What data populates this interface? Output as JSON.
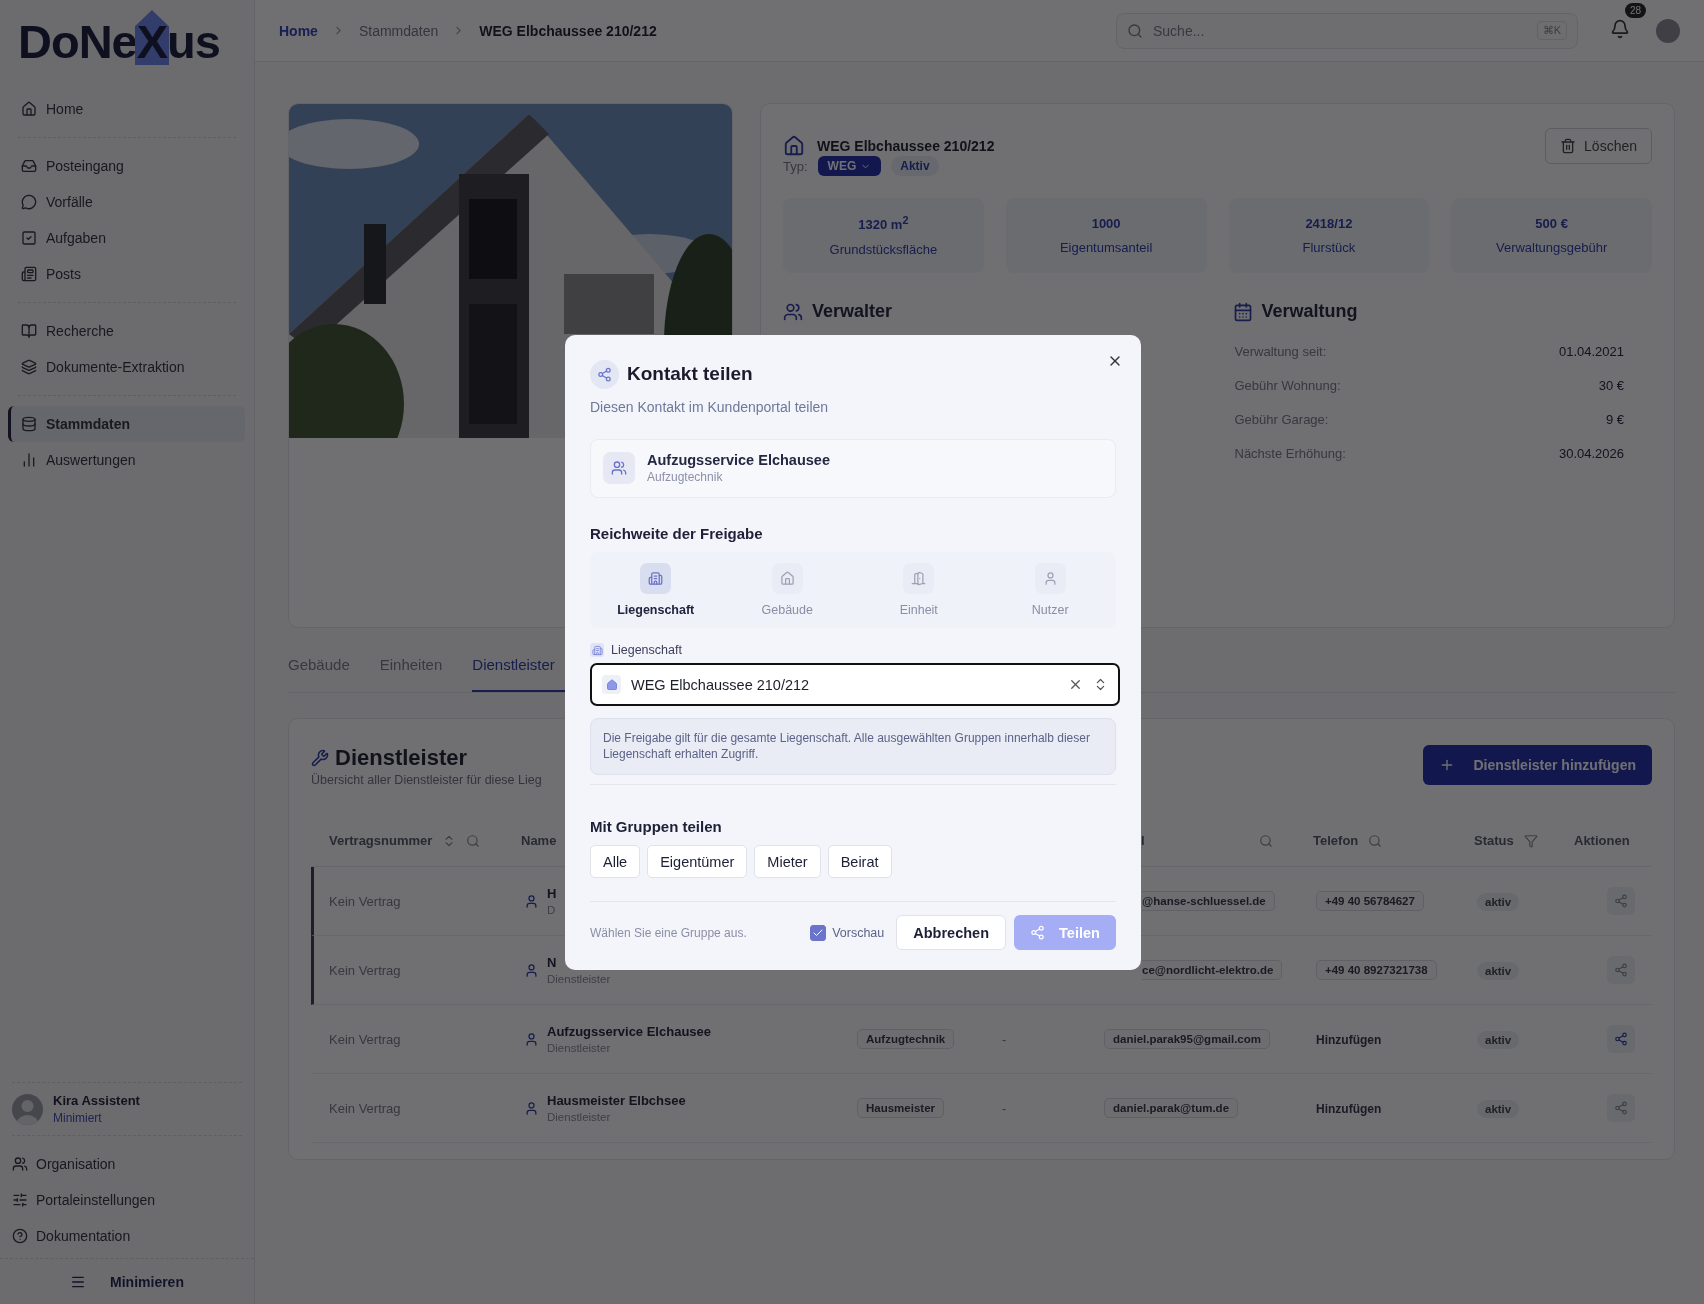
{
  "sidebar": {
    "logo": {
      "before": "DoNe",
      "mark": "X",
      "after": "us"
    },
    "nav_groups": [
      [
        {
          "label": "Home",
          "selected": false
        }
      ],
      [
        {
          "label": "Posteingang",
          "selected": false
        },
        {
          "label": "Vorfälle",
          "selected": false
        },
        {
          "label": "Aufgaben",
          "selected": false
        },
        {
          "label": "Posts",
          "selected": false
        }
      ],
      [
        {
          "label": "Recherche",
          "selected": false
        },
        {
          "label": "Dokumente-Extraktion",
          "selected": false
        }
      ],
      [
        {
          "label": "Stammdaten",
          "selected": true
        },
        {
          "label": "Auswertungen",
          "selected": false
        }
      ]
    ],
    "assistant": {
      "name": "Kira Assistent",
      "status": "Minimiert"
    },
    "footer_nav": [
      {
        "label": "Organisation"
      },
      {
        "label": "Portaleinstellungen"
      },
      {
        "label": "Dokumentation"
      }
    ],
    "collapse": "Minimieren"
  },
  "header": {
    "breadcrumb": [
      "Home",
      "Stammdaten",
      "WEG Elbchaussee 210/212"
    ],
    "search": {
      "placeholder": "Suche...",
      "shortcut": "⌘K"
    },
    "notifications": "28"
  },
  "property": {
    "title": "WEG Elbchaussee 210/212",
    "type_label": "Typ:",
    "type": "WEG",
    "status": "Aktiv",
    "delete": "Löschen",
    "stats": [
      {
        "value": "1320 m$^{2}$",
        "label": "Grundstücksfläche"
      },
      {
        "value": "1000",
        "label": "Eigentumsanteil"
      },
      {
        "value": "2418/12",
        "label": "Flurstück"
      },
      {
        "value": "500 €",
        "label": "Verwaltungsgebühr"
      }
    ],
    "manager_heading": "Verwalter",
    "admin": {
      "heading": "Verwaltung",
      "rows": [
        {
          "label": "Verwaltung seit:",
          "value": "01.04.2021"
        },
        {
          "label": "Gebühr Wohnung:",
          "value": "30 €"
        },
        {
          "label": "Gebühr Garage:",
          "value": "9 €"
        },
        {
          "label": "Nächste Erhöhung:",
          "value": "30.04.2026"
        }
      ]
    }
  },
  "tabs": [
    {
      "label": "Gebäude",
      "selected": false
    },
    {
      "label": "Einheiten",
      "selected": false
    },
    {
      "label": "Dienstleister",
      "selected": true
    }
  ],
  "providers": {
    "title": "Dienstleister",
    "subtitle": "Übersicht aller Dienstleister für diese Lieg",
    "add": "Dienstleister hinzufügen",
    "columns": [
      {
        "label": "Vertragsnummer",
        "sortable": true,
        "searchable": true
      },
      {
        "label": "Name"
      },
      {
        "label": "l",
        "searchable": true,
        "cut": true
      },
      {
        "label": "Telefon",
        "searchable": true
      },
      {
        "label": "Status",
        "filterable": true
      },
      {
        "label": "Aktionen"
      }
    ],
    "rows": [
      {
        "contract": "Kein Vertrag",
        "name": "H",
        "role": "D",
        "email": {
          "text": "@hanse-schluessel.de",
          "cut": true
        },
        "phone": {
          "kind": "number",
          "text": "+49 40 56784627"
        },
        "status": "aktiv",
        "highlighted": true,
        "active": false
      },
      {
        "contract": "Kein Vertrag",
        "name": "N",
        "role": "Dienstleister",
        "email": {
          "text": "ce@nordlicht-elektro.de",
          "cut": true
        },
        "phone": {
          "kind": "number",
          "text": "+49 40 8927321738"
        },
        "status": "aktiv",
        "highlighted": true,
        "active": false
      },
      {
        "contract": "Kein Vertrag",
        "name": "Aufzugsservice Elchausee",
        "role": "Dienstleister",
        "category": "Aufzugtechnik",
        "extra": "-",
        "email": {
          "text": "daniel.parak95@gmail.com",
          "cut": false
        },
        "phone": {
          "kind": "add",
          "text": "Hinzufügen"
        },
        "status": "aktiv",
        "highlighted": false,
        "active": true
      },
      {
        "contract": "Kein Vertrag",
        "name": "Hausmeister Elbchsee",
        "role": "Dienstleister",
        "category": "Hausmeister",
        "extra": "-",
        "email": {
          "text": "daniel.parak@tum.de",
          "cut": false
        },
        "phone": {
          "kind": "add",
          "text": "Hinzufügen"
        },
        "status": "aktiv",
        "highlighted": false,
        "active": false
      }
    ]
  },
  "dialog": {
    "title": "Kontakt teilen",
    "subtitle": "Diesen Kontakt im Kundenportal teilen",
    "contact": {
      "name": "Aufzugsservice Elchausee",
      "category": "Aufzugtechnik"
    },
    "scope_heading": "Reichweite der Freigabe",
    "scopes": [
      {
        "label": "Liegenschaft",
        "selected": true
      },
      {
        "label": "Gebäude",
        "selected": false
      },
      {
        "label": "Einheit",
        "selected": false
      },
      {
        "label": "Nutzer",
        "selected": false
      }
    ],
    "field": {
      "label": "Liegenschaft",
      "value": "WEG Elbchaussee 210/212"
    },
    "info": "Die Freigabe gilt für die gesamte Liegenschaft. Alle ausgewählten Gruppen innerhalb dieser Liegenschaft erhalten Zugriff.",
    "groups_heading": "Mit Gruppen teilen",
    "groups": [
      {
        "label": "Alle",
        "selected": false
      },
      {
        "label": "Eigentümer",
        "selected": false
      },
      {
        "label": "Mieter",
        "selected": false
      },
      {
        "label": "Beirat",
        "selected": false
      }
    ],
    "hint": "Wählen Sie eine Gruppe aus.",
    "preview": {
      "label": "Vorschau",
      "checked": true
    },
    "cancel": "Abbrechen",
    "submit": {
      "label": "Teilen",
      "disabled": true
    }
  }
}
